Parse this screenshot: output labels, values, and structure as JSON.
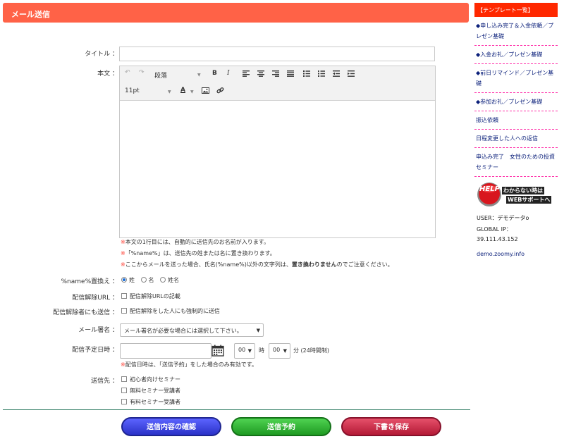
{
  "header": {
    "title": "メール送信"
  },
  "form": {
    "title_label": "タイトル ：",
    "body_label": "本文 ：",
    "editor": {
      "paragraph_select": "段落",
      "font_size": "11pt",
      "bold": "B",
      "italic": "I",
      "text_color": "A"
    },
    "notes": [
      {
        "mark": "※",
        "text": "本文の1行目には、自動的に送信先のお名前が入ります。"
      },
      {
        "mark": "※",
        "text": "「%name%」は、送信先の姓または名に置き換わります。"
      },
      {
        "mark": "※",
        "text_a": "ここからメールを送った場合、氏名(%name%)以外の文字列は、",
        "text_bold": "置き換わりません",
        "text_b": "のでご注意ください。"
      }
    ],
    "name_replace": {
      "label": "%name%置換え ：",
      "options": [
        "姓",
        "名",
        "姓名"
      ],
      "selected": "姓"
    },
    "unsubscribe_url": {
      "label": "配信解除URL ：",
      "checkbox_label": "配信解除URLの記載"
    },
    "unsubscribed_send": {
      "label": "配信解除者にも送信 ：",
      "checkbox_label": "配信解除をした人にも強制的に送信"
    },
    "signature": {
      "label": "メール署名 ：",
      "value": "メール署名が必要な場合には選択して下さい。"
    },
    "schedule": {
      "label": "配信予定日時 ：",
      "hour": "00",
      "hour_suffix": "時",
      "minute": "00",
      "minute_suffix": "分 (24時間制)",
      "note_mark": "※",
      "note": "配信日時は、「送信予約」をした場合のみ有効です。"
    },
    "recipients": {
      "label": "送信先 ：",
      "items": [
        "初心者向けセミナー",
        "無料セミナー受講者",
        "有料セミナー受講者"
      ]
    }
  },
  "buttons": {
    "confirm": "送信内容の確認",
    "reserve": "送信予約",
    "draft": "下書き保存"
  },
  "sidebar": {
    "heading": "【テンプレート一覧】",
    "items": [
      "◆申し込み完了＆入金依頼／プレゼン基礎",
      "◆入金お礼／プレゼン基礎",
      "◆前日リマインド／プレゼン基礎",
      "◆参加お礼／プレゼン基礎",
      "振込依頼",
      "日程変更した人への返信",
      "申込み完了　女性のための投資セミナー"
    ],
    "help": {
      "badge": "HELP",
      "line1": "わからない時は",
      "line2": "WEBサポートへ"
    },
    "user": "USER：デモデータo",
    "ip_label": "GLOBAL IP：",
    "ip": "39.111.43.152",
    "link": "demo.zoomy.info"
  },
  "colors": {
    "header": "#ff6247",
    "sidebar_head": "#ff2800",
    "note_mark": "#ff3b30",
    "button_blue": "#2b32c8",
    "button_green": "#1f9a22",
    "button_red": "#b41a36"
  }
}
